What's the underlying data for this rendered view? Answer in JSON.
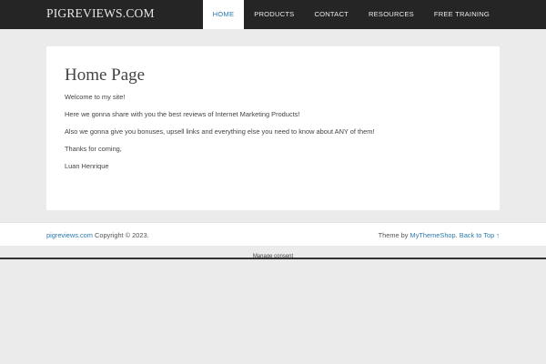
{
  "header": {
    "logo": "PIGREVIEWS.COM",
    "nav": [
      {
        "label": "HOME",
        "active": true
      },
      {
        "label": "PRODUCTS",
        "active": false
      },
      {
        "label": "CONTACT",
        "active": false
      },
      {
        "label": "RESOURCES",
        "active": false
      },
      {
        "label": "FREE TRAINING",
        "active": false
      }
    ]
  },
  "main": {
    "title": "Home Page",
    "paragraphs": [
      "Welcome to my site!",
      "Here we gonna share with you the best reviews of Internet Marketing Products!",
      "Also we gonna give you bonuses, upsell links and everything else you need to know about ANY of them!",
      "Thanks for coming,",
      "Luan Henrique"
    ]
  },
  "footer": {
    "site_link": "pigreviews.com",
    "copyright": " Copyright © 2023.",
    "theme_prefix": "Theme by ",
    "theme_link": "MyThemeShop",
    "theme_suffix": ". ",
    "back_to_top": "Back to Top ↑"
  },
  "consent": {
    "label": "Manage consent"
  },
  "colors": {
    "topbar": "#252525",
    "accent": "#2a7ab0",
    "page_bg": "#ebebeb"
  }
}
